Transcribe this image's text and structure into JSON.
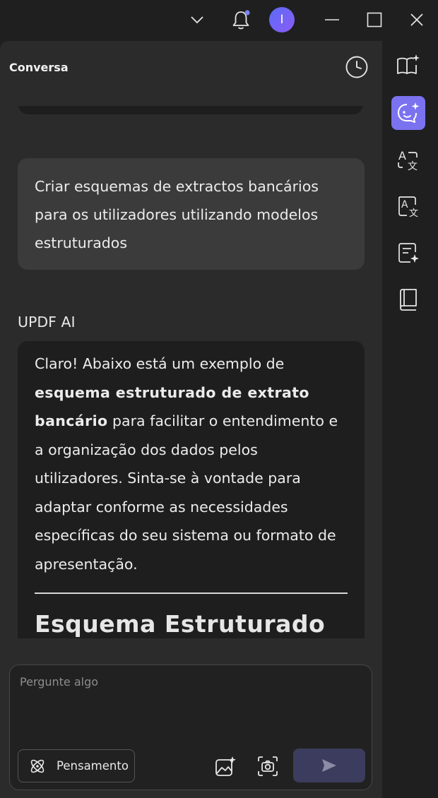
{
  "titlebar": {
    "avatar_initial": "I",
    "icons": [
      "chevron-down-icon",
      "bell-icon",
      "minimize-icon",
      "maximize-icon",
      "close-icon"
    ]
  },
  "panel": {
    "title": "Conversa"
  },
  "chat": {
    "user_message": "Criar esquemas de extractos bancários para os utilizadores utilizando modelos estruturados",
    "ai_label": "UPDF AI",
    "ai_intro": "Claro! Abaixo está um exemplo de ",
    "ai_bold": "esquema estruturado de extrato bancário",
    "ai_rest": " para facilitar o entendimento e a organização dos dados pelos utilizadores. Sinta-se à vontade para adaptar conforme as necessidades específicas do seu sistema ou formato de apresentação.",
    "ai_heading": "Esquema Estruturado de Extrato Bancário"
  },
  "input": {
    "placeholder": "Pergunte algo",
    "thinking_label": "Pensamento"
  },
  "sidebar": {
    "items": [
      "book-sparkle-icon",
      "chat-bot-icon",
      "translate-icon",
      "translate-doc-icon",
      "summary-icon",
      "book-icon"
    ],
    "active_index": 1
  },
  "colors": {
    "accent": "#7b72f0",
    "panel_bg": "#2b2b2b",
    "window_bg": "#1f1f1f"
  }
}
